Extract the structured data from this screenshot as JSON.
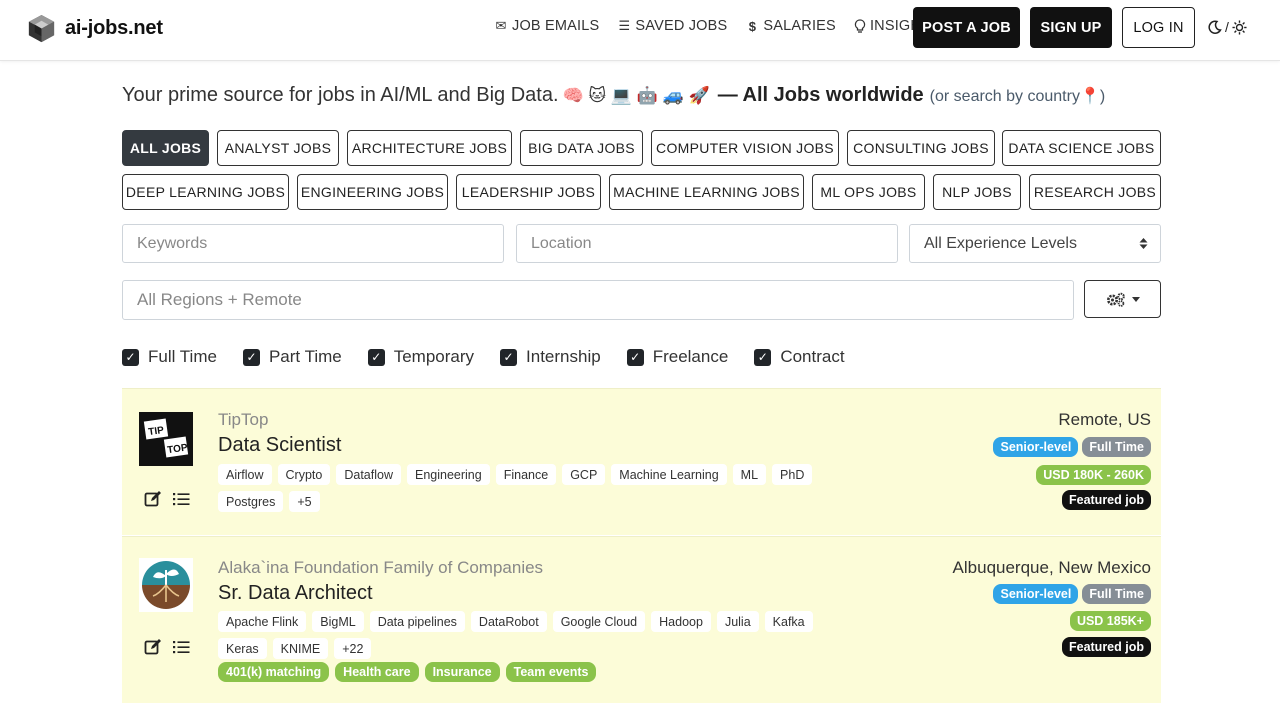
{
  "brand": {
    "name": "ai-jobs.net"
  },
  "nav": {
    "links": [
      {
        "icon": "envelope-icon",
        "glyph": "✉",
        "label": "JOB EMAILS"
      },
      {
        "icon": "list-icon",
        "glyph": "☰",
        "label": "SAVED JOBS"
      },
      {
        "icon": "dollar-icon",
        "glyph": "$",
        "label": "SALARIES"
      },
      {
        "icon": "lightbulb-icon",
        "glyph": "♀",
        "label": "INSIGHTS"
      }
    ],
    "post_job": "POST A JOB",
    "sign_up": "SIGN UP",
    "log_in": "LOG IN",
    "theme_separator": "/"
  },
  "tagline": {
    "text": "Your prime source for jobs in AI/ML and Big Data.",
    "emojis": "🧠 🐱 💻 🤖 🚙 🚀",
    "strong": "— All Jobs worldwide",
    "small": "(or search by country📍)"
  },
  "categories": {
    "row1": [
      "ALL JOBS",
      "ANALYST JOBS",
      "ARCHITECTURE JOBS",
      "BIG DATA JOBS",
      "COMPUTER VISION JOBS",
      "CONSULTING JOBS",
      "DATA SCIENCE JOBS"
    ],
    "row2": [
      "DEEP LEARNING JOBS",
      "ENGINEERING JOBS",
      "LEADERSHIP JOBS",
      "MACHINE LEARNING JOBS",
      "ML OPS JOBS",
      "NLP JOBS",
      "RESEARCH JOBS"
    ]
  },
  "filters": {
    "keywords_placeholder": "Keywords",
    "location_placeholder": "Location",
    "experience_selected": "All Experience Levels",
    "regions_placeholder": "All Regions + Remote",
    "job_types": [
      "Full Time",
      "Part Time",
      "Temporary",
      "Internship",
      "Freelance",
      "Contract"
    ]
  },
  "jobs": [
    {
      "company": "TipTop",
      "title": "Data Scientist",
      "logo_text_1": "TIP",
      "logo_text_2": "TOP",
      "tags": [
        "Airflow",
        "Crypto",
        "Dataflow",
        "Engineering",
        "Finance",
        "GCP",
        "Machine Learning",
        "ML",
        "PhD",
        "Postgres",
        "+5"
      ],
      "benefits": [],
      "location": "Remote, US",
      "level": "Senior-level",
      "type": "Full Time",
      "salary": "USD 180K - 260K",
      "featured": "Featured job"
    },
    {
      "company": "Alaka`ina Foundation Family of Companies",
      "title": "Sr. Data Architect",
      "tags": [
        "Apache Flink",
        "BigML",
        "Data pipelines",
        "DataRobot",
        "Google Cloud",
        "Hadoop",
        "Julia",
        "Kafka",
        "Keras",
        "KNIME",
        "+22"
      ],
      "benefits": [
        "401(k) matching",
        "Health care",
        "Insurance",
        "Team events"
      ],
      "location": "Albuquerque, New Mexico",
      "level": "Senior-level",
      "type": "Full Time",
      "salary": "USD 185K+",
      "featured": "Featured job"
    }
  ]
}
